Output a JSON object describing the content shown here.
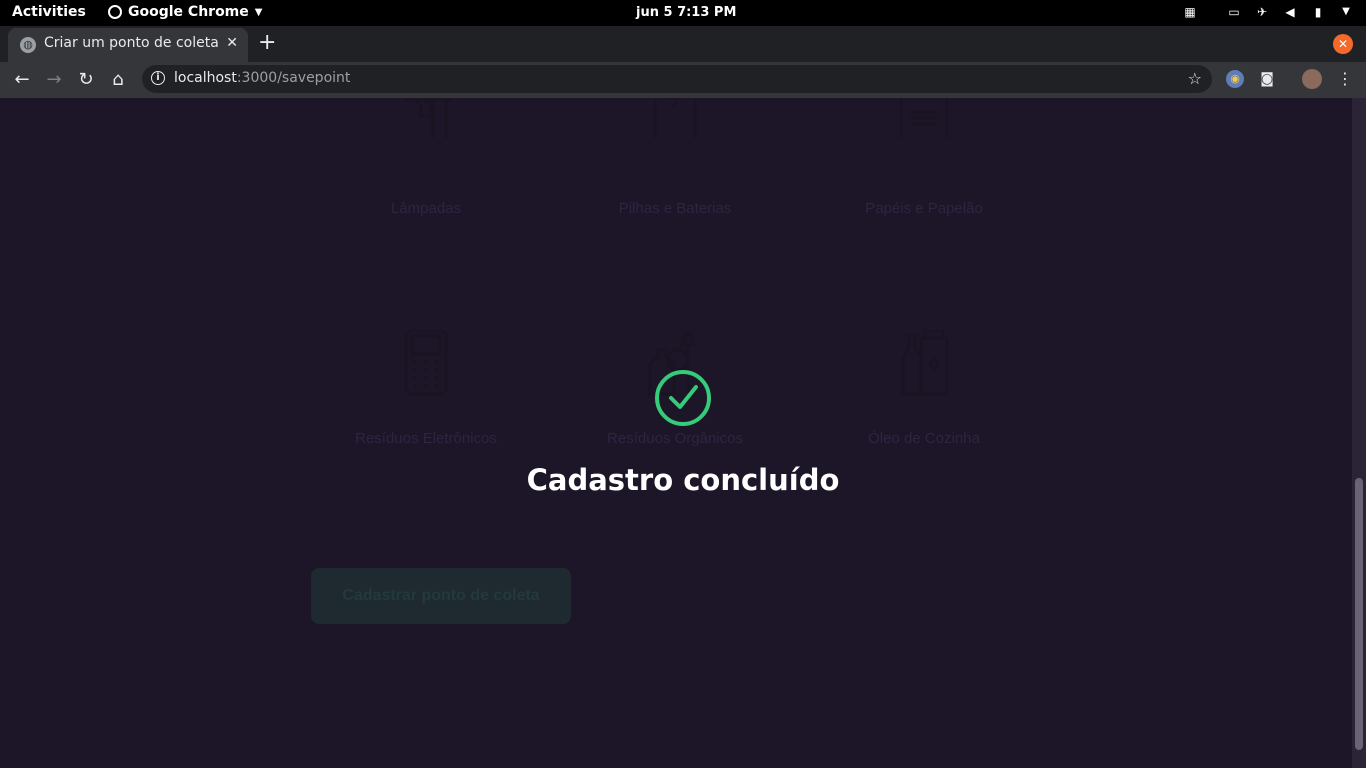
{
  "system_bar": {
    "activities": "Activities",
    "app_name": "Google Chrome",
    "clock": "jun 5   7:13 PM"
  },
  "browser": {
    "tab_title": "Criar um ponto de coleta",
    "url_host": "localhost",
    "url_path": ":3000/savepoint"
  },
  "page": {
    "items": [
      {
        "label": "Lâmpadas",
        "icon": "lamp-icon"
      },
      {
        "label": "Pilhas e Baterias",
        "icon": "battery-icon"
      },
      {
        "label": "Papéis e Papelão",
        "icon": "paper-icon"
      },
      {
        "label": "Resíduos Eletrônicos",
        "icon": "electronics-icon"
      },
      {
        "label": "Resíduos Orgânicos",
        "icon": "organic-icon"
      },
      {
        "label": "Óleo de Cozinha",
        "icon": "oil-icon"
      }
    ],
    "submit_label": "Cadastrar ponto de coleta"
  },
  "modal": {
    "message": "Cadastro concluído",
    "accent_color": "#34cb79"
  }
}
